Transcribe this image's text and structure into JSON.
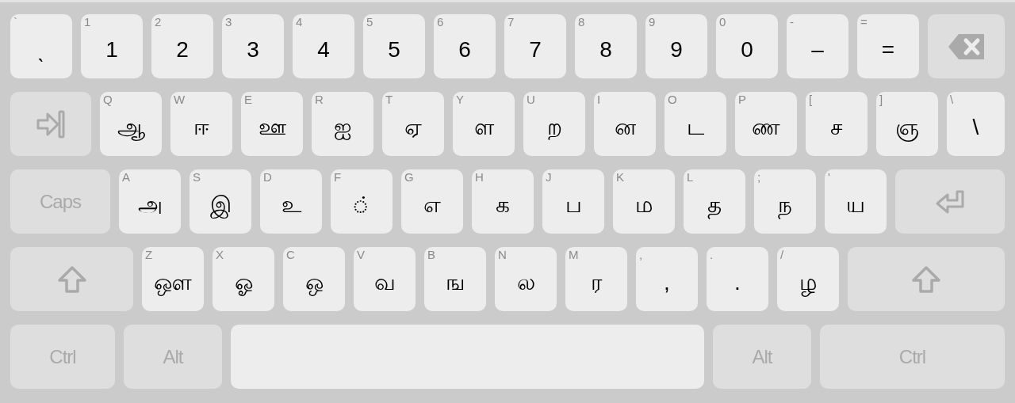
{
  "rows": [
    {
      "keys": [
        {
          "kind": "char",
          "hint": "`",
          "label": "ˎ"
        },
        {
          "kind": "char",
          "hint": "1",
          "label": "1"
        },
        {
          "kind": "char",
          "hint": "2",
          "label": "2"
        },
        {
          "kind": "char",
          "hint": "3",
          "label": "3"
        },
        {
          "kind": "char",
          "hint": "4",
          "label": "4"
        },
        {
          "kind": "char",
          "hint": "5",
          "label": "5"
        },
        {
          "kind": "char",
          "hint": "6",
          "label": "6"
        },
        {
          "kind": "char",
          "hint": "7",
          "label": "7"
        },
        {
          "kind": "char",
          "hint": "8",
          "label": "8"
        },
        {
          "kind": "char",
          "hint": "9",
          "label": "9"
        },
        {
          "kind": "char",
          "hint": "0",
          "label": "0"
        },
        {
          "kind": "char",
          "hint": "-",
          "label": "–"
        },
        {
          "kind": "char",
          "hint": "=",
          "label": "="
        },
        {
          "kind": "backspace"
        }
      ]
    },
    {
      "keys": [
        {
          "kind": "tab"
        },
        {
          "kind": "char",
          "hint": "Q",
          "label": "ஆ"
        },
        {
          "kind": "char",
          "hint": "W",
          "label": "ஈ"
        },
        {
          "kind": "char",
          "hint": "E",
          "label": "ஊ"
        },
        {
          "kind": "char",
          "hint": "R",
          "label": "ஐ"
        },
        {
          "kind": "char",
          "hint": "T",
          "label": "ஏ"
        },
        {
          "kind": "char",
          "hint": "Y",
          "label": "ள"
        },
        {
          "kind": "char",
          "hint": "U",
          "label": "ற"
        },
        {
          "kind": "char",
          "hint": "I",
          "label": "ன"
        },
        {
          "kind": "char",
          "hint": "O",
          "label": "ட"
        },
        {
          "kind": "char",
          "hint": "P",
          "label": "ண"
        },
        {
          "kind": "char",
          "hint": "[",
          "label": "ச"
        },
        {
          "kind": "char",
          "hint": "]",
          "label": "ஞ"
        },
        {
          "kind": "wide-char",
          "hint": "\\",
          "label": "\\"
        }
      ]
    },
    {
      "keys": [
        {
          "kind": "caps",
          "label": "Caps"
        },
        {
          "kind": "char",
          "hint": "A",
          "label": "அ"
        },
        {
          "kind": "char",
          "hint": "S",
          "label": "இ"
        },
        {
          "kind": "char",
          "hint": "D",
          "label": "உ"
        },
        {
          "kind": "char",
          "hint": "F",
          "label": "◌்"
        },
        {
          "kind": "char",
          "hint": "G",
          "label": "எ"
        },
        {
          "kind": "char",
          "hint": "H",
          "label": "க"
        },
        {
          "kind": "char",
          "hint": "J",
          "label": "ப"
        },
        {
          "kind": "char",
          "hint": "K",
          "label": "ம"
        },
        {
          "kind": "char",
          "hint": "L",
          "label": "த"
        },
        {
          "kind": "char",
          "hint": ";",
          "label": "ந"
        },
        {
          "kind": "char",
          "hint": "'",
          "label": "ய"
        },
        {
          "kind": "enter"
        }
      ]
    },
    {
      "keys": [
        {
          "kind": "shift"
        },
        {
          "kind": "char",
          "hint": "Z",
          "label": "ஔ"
        },
        {
          "kind": "char",
          "hint": "X",
          "label": "ஓ"
        },
        {
          "kind": "char",
          "hint": "C",
          "label": "ஒ"
        },
        {
          "kind": "char",
          "hint": "V",
          "label": "வ"
        },
        {
          "kind": "char",
          "hint": "B",
          "label": "ங"
        },
        {
          "kind": "char",
          "hint": "N",
          "label": "ல"
        },
        {
          "kind": "char",
          "hint": "M",
          "label": "ர"
        },
        {
          "kind": "char",
          "hint": ",",
          "label": ","
        },
        {
          "kind": "char",
          "hint": ".",
          "label": "."
        },
        {
          "kind": "char",
          "hint": "/",
          "label": "ழ"
        },
        {
          "kind": "shift-wide"
        }
      ]
    },
    {
      "keys": [
        {
          "kind": "ctrl",
          "label": "Ctrl"
        },
        {
          "kind": "alt",
          "label": "Alt"
        },
        {
          "kind": "space"
        },
        {
          "kind": "alt",
          "label": "Alt"
        },
        {
          "kind": "ctrl-wide",
          "label": "Ctrl"
        }
      ]
    }
  ]
}
